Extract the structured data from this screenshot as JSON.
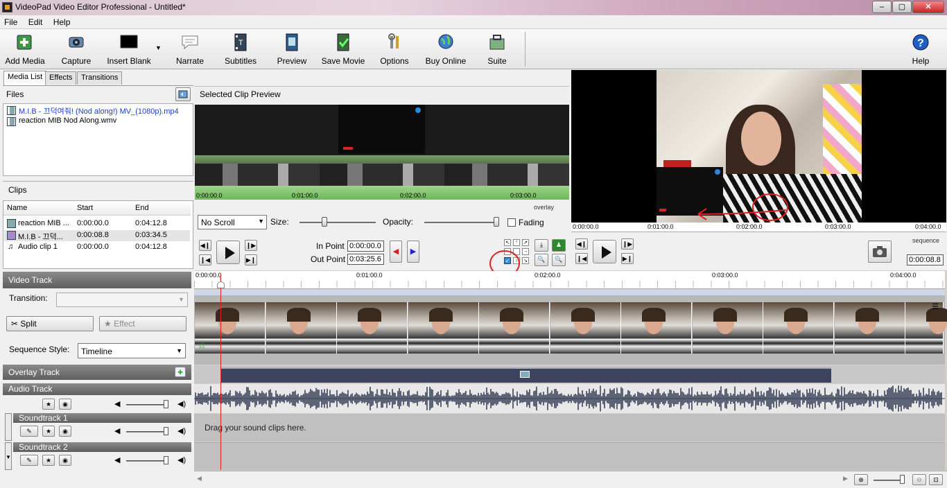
{
  "window": {
    "title": "VideoPad Video Editor Professional - Untitled*",
    "min": "–",
    "max": "▢",
    "close": "✕"
  },
  "menu": [
    "File",
    "Edit",
    "Help"
  ],
  "toolbar": {
    "add_media": "Add Media",
    "capture": "Capture",
    "insert_blank": "Insert Blank",
    "narrate": "Narrate",
    "subtitles": "Subtitles",
    "preview": "Preview",
    "save_movie": "Save Movie",
    "options": "Options",
    "buy_online": "Buy Online",
    "suite": "Suite",
    "help": "Help"
  },
  "tabs": [
    "Media List",
    "Effects",
    "Transitions"
  ],
  "files": {
    "header": "Files",
    "items": [
      "M.I.B - 끄덕여줘! (Nod along!) MV_(1080p).mp4",
      "reaction MIB Nod Along.wmv"
    ]
  },
  "clips": {
    "header": "Clips",
    "columns": [
      "Name",
      "Start",
      "End"
    ],
    "rows": [
      [
        "reaction MIB ...",
        "0:00:00.0",
        "0:04:12.8"
      ],
      [
        "M.I.B - 끄덕...",
        "0:00:08.8",
        "0:03:34.5"
      ],
      [
        "Audio clip 1",
        "0:00:00.0",
        "0:04:12.8"
      ]
    ]
  },
  "clip_preview": {
    "header": "Selected Clip Preview",
    "ruler": [
      "0:00:00.0",
      "0:01:00.0",
      "0:02:00.0",
      "0:03:00.0"
    ],
    "overlay_label": "overlay",
    "scroll_select": "No Scroll",
    "size_label": "Size:",
    "size_value": 0.33,
    "opacity_label": "Opacity:",
    "opacity_value": 0.98,
    "fading_label": "Fading",
    "in_point_label": "In Point",
    "in_point": "0:00:00.0",
    "out_point_label": "Out Point",
    "out_point": "0:03:25.6"
  },
  "sequence_preview": {
    "ruler": [
      "0:00:00.0",
      "0:01:00.0",
      "0:02:00.0",
      "0:03:00.0",
      "0:04:00.0"
    ],
    "label": "sequence",
    "time": "0:00:08.8"
  },
  "tracks": {
    "video_track": "Video Track",
    "transition_label": "Transition:",
    "split": "Split",
    "effect": "Effect",
    "sequence_style_label": "Sequence Style:",
    "sequence_style": "Timeline",
    "overlay_track": "Overlay Track",
    "audio_track": "Audio Track",
    "soundtrack1": "Soundtrack 1",
    "soundtrack2": "Soundtrack 2",
    "drag_hint": "Drag your sound clips here.",
    "ruler": [
      "0:00:00.0",
      "0:01:00.0",
      "0:02:00.0",
      "0:03:00.0",
      "0:04:00.0"
    ]
  },
  "colors": {
    "accent_red": "#e02020",
    "track_dark": "#3d4460",
    "waveform": "#3a4258"
  }
}
